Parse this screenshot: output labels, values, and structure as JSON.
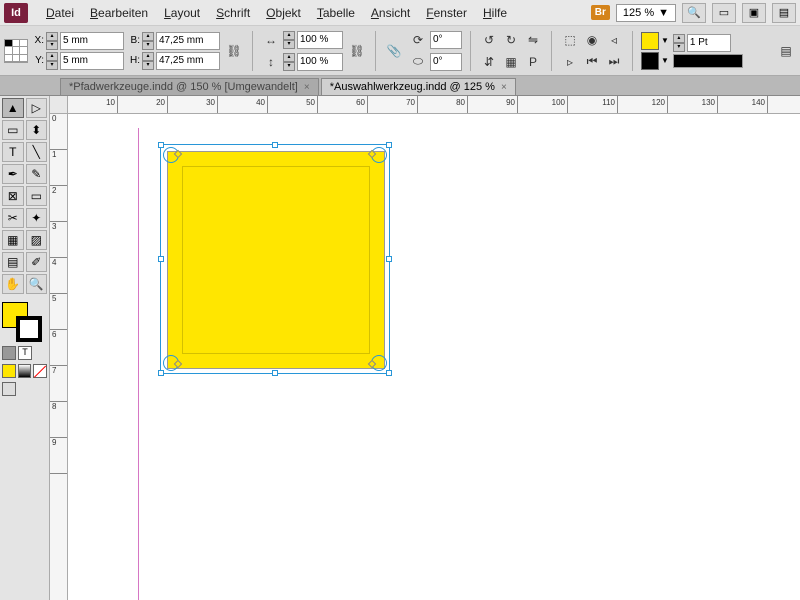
{
  "app": {
    "logo": "Id"
  },
  "menu": {
    "datei": "Datei",
    "bearbeiten": "Bearbeiten",
    "layout": "Layout",
    "schrift": "Schrift",
    "objekt": "Objekt",
    "tabelle": "Tabelle",
    "ansicht": "Ansicht",
    "fenster": "Fenster",
    "hilfe": "Hilfe",
    "bridge": "Br",
    "zoom": "125 %"
  },
  "control": {
    "x_label": "X:",
    "x": "5 mm",
    "y_label": "Y:",
    "y": "5 mm",
    "w_label": "B:",
    "w": "47,25 mm",
    "h_label": "H:",
    "h": "47,25 mm",
    "scale_x": "100 %",
    "scale_y": "100 %",
    "rotate": "0°",
    "shear": "0°",
    "stroke_weight": "1 Pt",
    "fill_color": "#ffe600",
    "stroke_color": "#000000"
  },
  "tabs": {
    "tab1": "*Pfadwerkzeuge.indd @ 150 % [Umgewandelt]",
    "tab2": "*Auswahlwerkzeug.indd @ 125 %"
  },
  "ruler": {
    "h": [
      "10",
      "20",
      "30",
      "40",
      "50",
      "60",
      "70",
      "80",
      "90",
      "100",
      "110",
      "120",
      "130",
      "140"
    ],
    "v": [
      "0",
      "1",
      "2",
      "3",
      "4",
      "5",
      "6",
      "7",
      "8",
      "9"
    ]
  }
}
